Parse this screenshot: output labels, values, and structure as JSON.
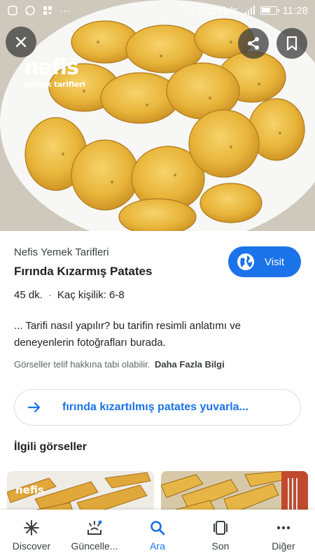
{
  "status_bar": {
    "speed": "27,31Kb/s",
    "time": "11:28",
    "dots": "···"
  },
  "image": {
    "watermark_brand": "nefis",
    "watermark_sub": "yemek tarifleri"
  },
  "result": {
    "source": "Nefis Yemek Tarifleri",
    "title": "Fırında Kızarmış Patates",
    "visit_label": "Visit",
    "duration": "45 dk.",
    "separator": "·",
    "servings": "Kaç kişilik: 6-8",
    "snippet": "... Tarifi nasıl yapılır? bu tarifin resimli anlatımı ve deneyenlerin fotoğrafları burada.",
    "copyright_text": "Görseller telif hakkına tabi olabilir.",
    "more_info_label": "Daha Fazla Bilgi"
  },
  "suggestion": {
    "text": "fırında kızartılmış patates yuvarla..."
  },
  "related": {
    "title": "İlgili görseller",
    "thumb1_watermark": "nefis"
  },
  "bottom_nav": {
    "items": [
      {
        "label": "Discover",
        "icon": "asterisk-icon"
      },
      {
        "label": "Güncelle...",
        "icon": "updates-icon"
      },
      {
        "label": "Ara",
        "icon": "search-icon"
      },
      {
        "label": "Son",
        "icon": "tabs-icon"
      },
      {
        "label": "Diğer",
        "icon": "more-icon"
      }
    ],
    "active_index": 2
  },
  "colors": {
    "accent": "#1a73e8",
    "text": "#202124",
    "muted": "#5f6368"
  }
}
